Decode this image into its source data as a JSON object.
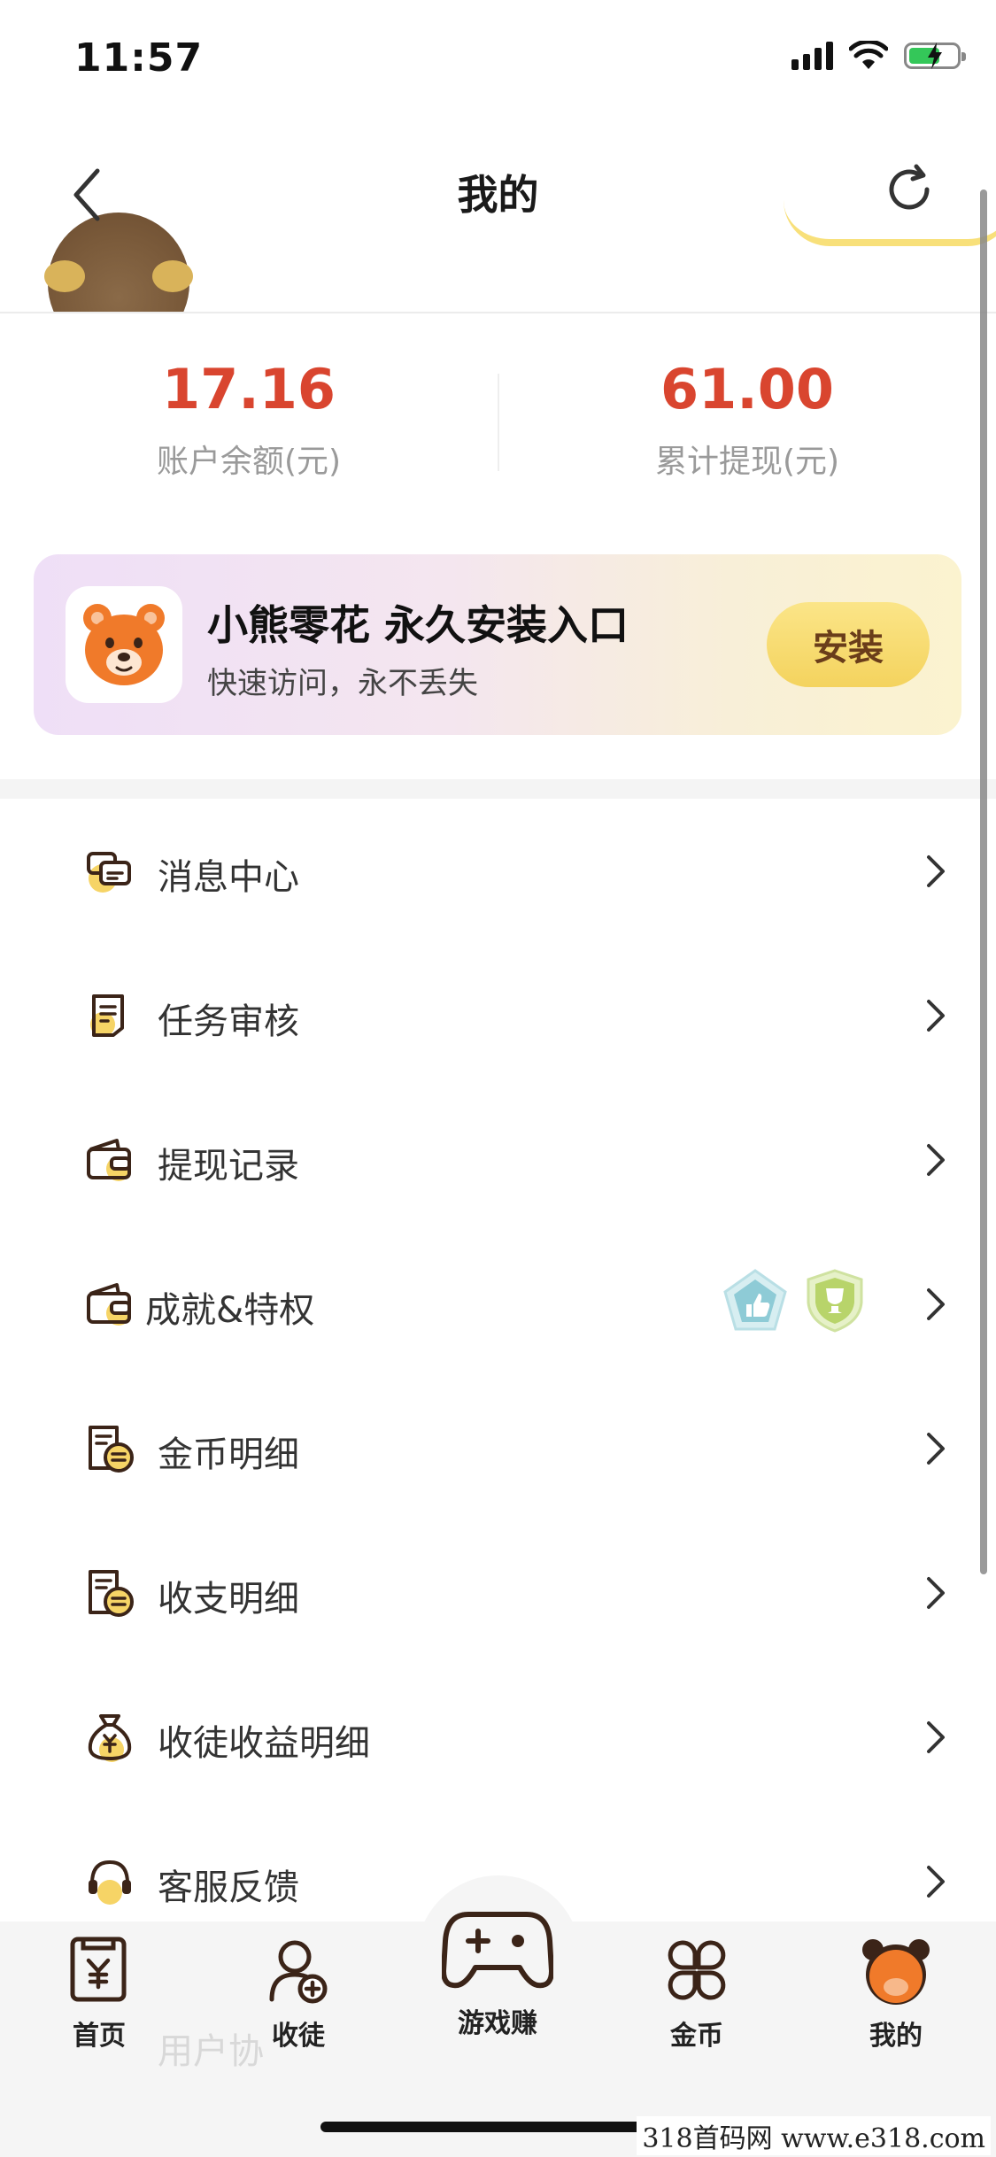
{
  "status_bar": {
    "time": "11:57"
  },
  "nav": {
    "title": "我的"
  },
  "stats": [
    {
      "value": "17.16",
      "label": "账户余额(元)"
    },
    {
      "value": "61.00",
      "label": "累计提现(元)"
    }
  ],
  "banner": {
    "title": "小熊零花 永久安装入口",
    "subtitle": "快速访问，永不丢失",
    "button": "安装"
  },
  "menu": [
    {
      "label": "消息中心",
      "icon": "message-icon"
    },
    {
      "label": "任务审核",
      "icon": "task-review-icon"
    },
    {
      "label": "提现记录",
      "icon": "wallet-icon"
    },
    {
      "label": "成就&特权",
      "icon": "wallet-icon",
      "badges": [
        "thumbs-up-badge-icon",
        "trophy-badge-icon"
      ]
    },
    {
      "label": "金币明细",
      "icon": "coin-detail-icon"
    },
    {
      "label": "收支明细",
      "icon": "income-detail-icon"
    },
    {
      "label": "收徒收益明细",
      "icon": "money-bag-icon"
    },
    {
      "label": "客服反馈",
      "icon": "headset-icon"
    }
  ],
  "faded_item": "用户协",
  "tabbar": [
    {
      "label": "首页",
      "icon": "home-yen-icon",
      "active": false
    },
    {
      "label": "收徒",
      "icon": "add-friend-icon",
      "active": false
    },
    {
      "label": "游戏赚",
      "icon": "gamepad-icon",
      "active": false
    },
    {
      "label": "金币",
      "icon": "grid-icon",
      "active": false
    },
    {
      "label": "我的",
      "icon": "bear-avatar-icon",
      "active": true
    }
  ],
  "watermark": "318首码网  www.e318.com",
  "colors": {
    "accent_red": "#d9452f",
    "install_yellow": "#f4d35e",
    "icon_brown": "#3b2418",
    "icon_dot": "#f6d466"
  }
}
